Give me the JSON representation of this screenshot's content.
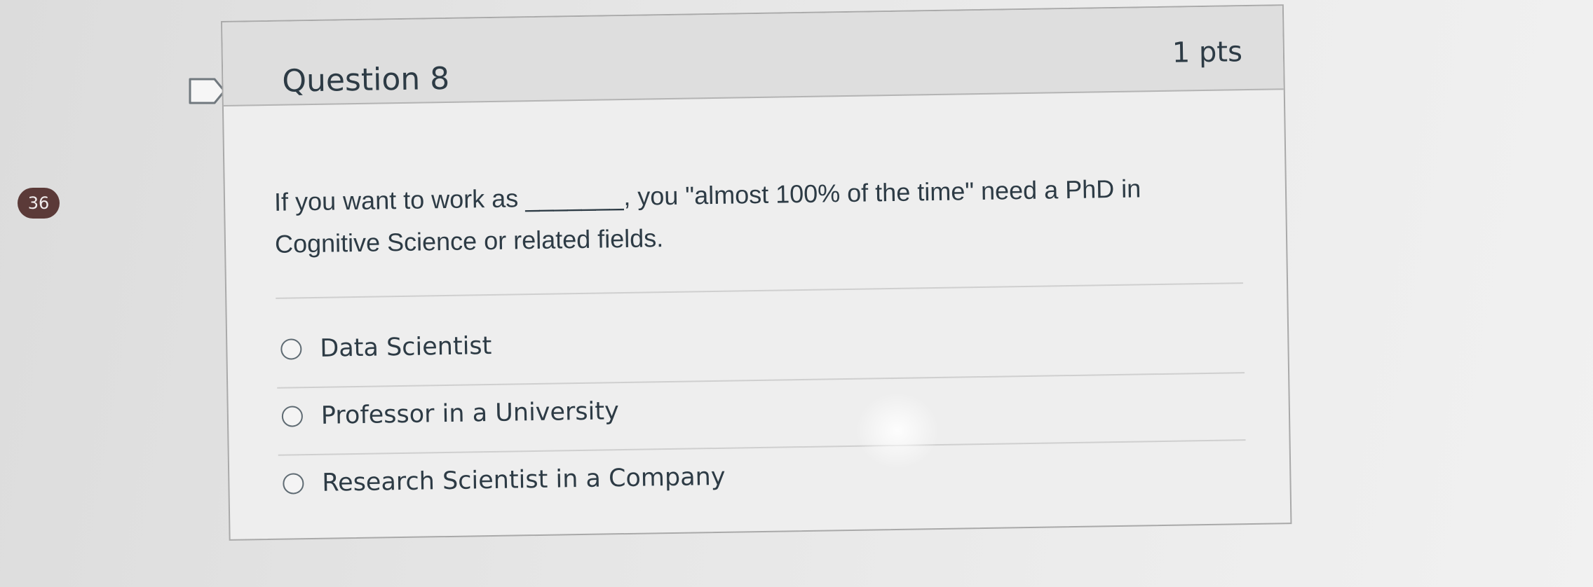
{
  "sidebar": {
    "counter": "36"
  },
  "question": {
    "title": "Question 8",
    "points": "1 pts",
    "text_line1": "If you want to work as _______, you \"almost 100% of the time\" need a PhD in",
    "text_line2": "Cognitive Science or related fields.",
    "answers": [
      {
        "label": "Data Scientist",
        "selected": false
      },
      {
        "label": "Professor in a University",
        "selected": false
      },
      {
        "label": "Research Scientist in a Company",
        "selected": false
      }
    ]
  },
  "icons": {
    "flag": "flag-outline-icon",
    "radio": "radio-empty-icon"
  },
  "colors": {
    "text": "#2d3b45",
    "header_bg": "#dedede",
    "badge": "#5b3a38"
  }
}
